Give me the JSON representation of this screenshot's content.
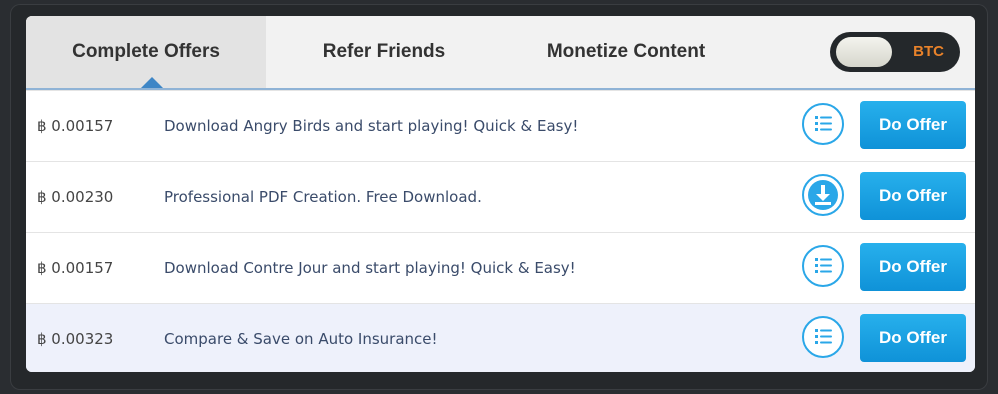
{
  "tabs": [
    {
      "label": "Complete Offers",
      "active": true
    },
    {
      "label": "Refer Friends",
      "active": false
    },
    {
      "label": "Monetize Content",
      "active": false
    }
  ],
  "currency_toggle": {
    "label": "BTC",
    "color": "#e8822a"
  },
  "offers": [
    {
      "amount": "฿ 0.00157",
      "description": "Download Angry Birds and start playing! Quick & Easy!",
      "icon": "list-icon",
      "button": "Do Offer"
    },
    {
      "amount": "฿ 0.00230",
      "description": "Professional PDF Creation. Free Download.",
      "icon": "download-icon",
      "button": "Do Offer"
    },
    {
      "amount": "฿ 0.00157",
      "description": "Download Contre Jour and start playing! Quick & Easy!",
      "icon": "list-icon",
      "button": "Do Offer"
    },
    {
      "amount": "฿ 0.00323",
      "description": "Compare & Save on Auto Insurance!",
      "icon": "list-icon",
      "button": "Do Offer"
    }
  ],
  "colors": {
    "accent": "#2aa7e8",
    "highlight_row": "#eef1fb"
  }
}
